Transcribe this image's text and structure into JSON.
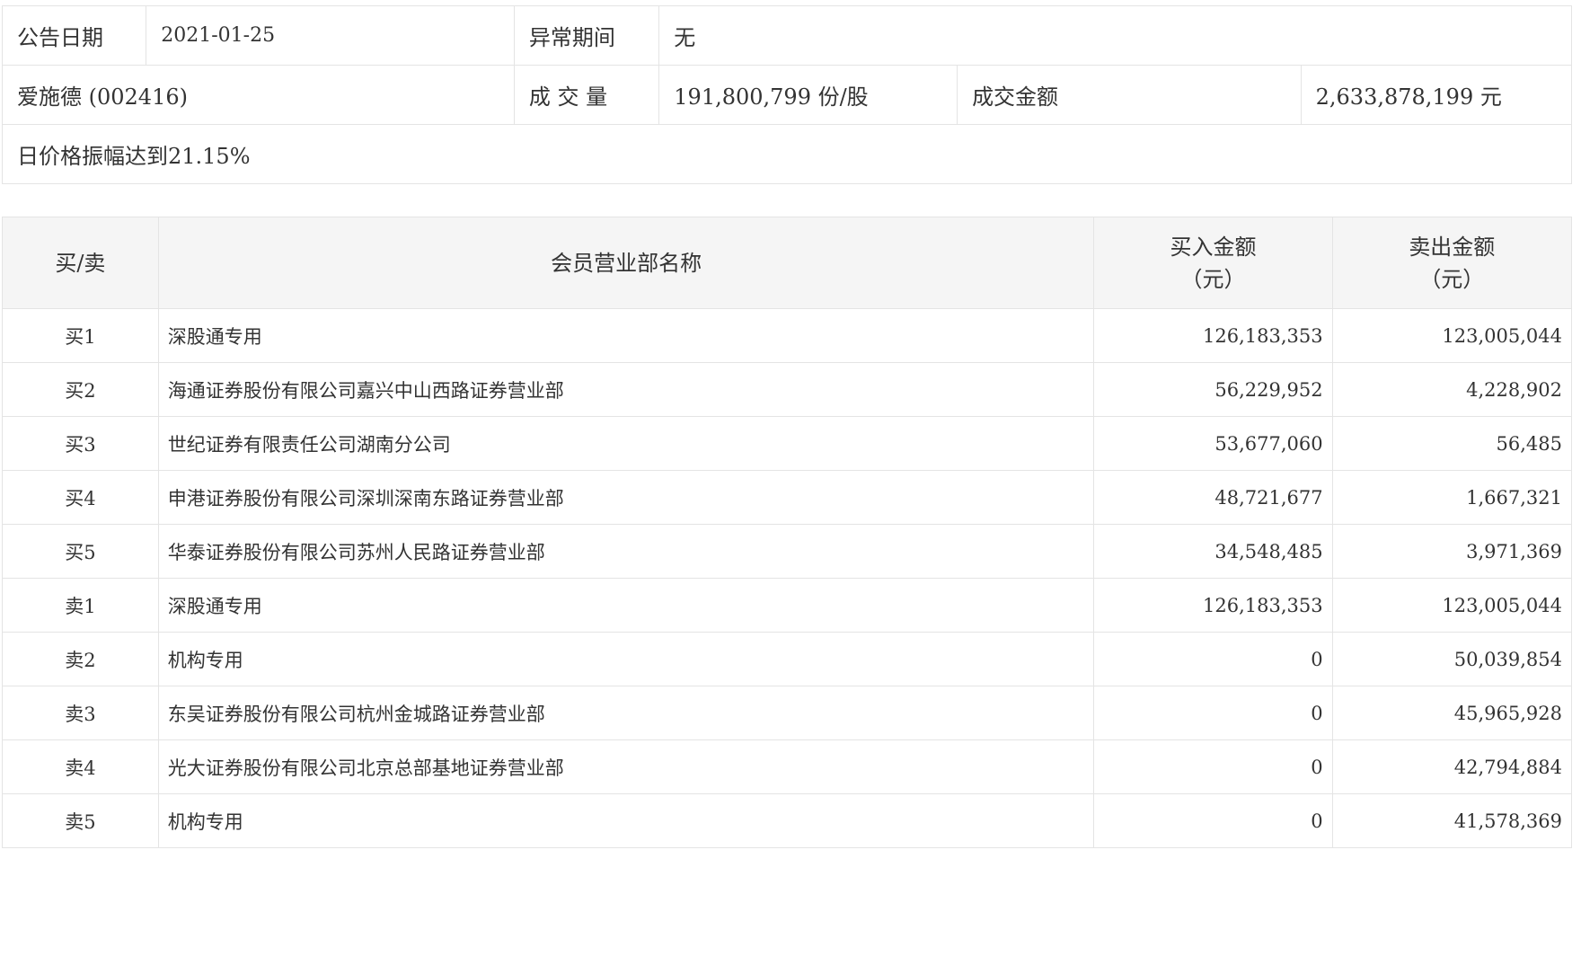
{
  "info": {
    "announce_date_label": "公告日期",
    "announce_date": "2021-01-25",
    "abnormal_period_label": "异常期间",
    "abnormal_period": "无",
    "stock": "爱施德 (002416)",
    "volume_label": "成 交 量",
    "volume": "191,800,799 份/股",
    "turnover_label": "成交金额",
    "turnover": "2,633,878,199 元",
    "reason": "日价格振幅达到21.15%"
  },
  "table": {
    "headers": {
      "side": "买/卖",
      "member": "会员营业部名称",
      "buy_line1": "买入金额",
      "buy_line2": "（元）",
      "sell_line1": "卖出金额",
      "sell_line2": "（元）"
    },
    "rows": [
      {
        "side": "买1",
        "name": "深股通专用",
        "buy": "126,183,353",
        "sell": "123,005,044"
      },
      {
        "side": "买2",
        "name": "海通证券股份有限公司嘉兴中山西路证券营业部",
        "buy": "56,229,952",
        "sell": "4,228,902"
      },
      {
        "side": "买3",
        "name": "世纪证券有限责任公司湖南分公司",
        "buy": "53,677,060",
        "sell": "56,485"
      },
      {
        "side": "买4",
        "name": "申港证券股份有限公司深圳深南东路证券营业部",
        "buy": "48,721,677",
        "sell": "1,667,321"
      },
      {
        "side": "买5",
        "name": "华泰证券股份有限公司苏州人民路证券营业部",
        "buy": "34,548,485",
        "sell": "3,971,369"
      },
      {
        "side": "卖1",
        "name": "深股通专用",
        "buy": "126,183,353",
        "sell": "123,005,044"
      },
      {
        "side": "卖2",
        "name": "机构专用",
        "buy": "0",
        "sell": "50,039,854"
      },
      {
        "side": "卖3",
        "name": "东吴证券股份有限公司杭州金城路证券营业部",
        "buy": "0",
        "sell": "45,965,928"
      },
      {
        "side": "卖4",
        "name": "光大证券股份有限公司北京总部基地证券营业部",
        "buy": "0",
        "sell": "42,794,884"
      },
      {
        "side": "卖5",
        "name": "机构专用",
        "buy": "0",
        "sell": "41,578,369"
      }
    ]
  }
}
